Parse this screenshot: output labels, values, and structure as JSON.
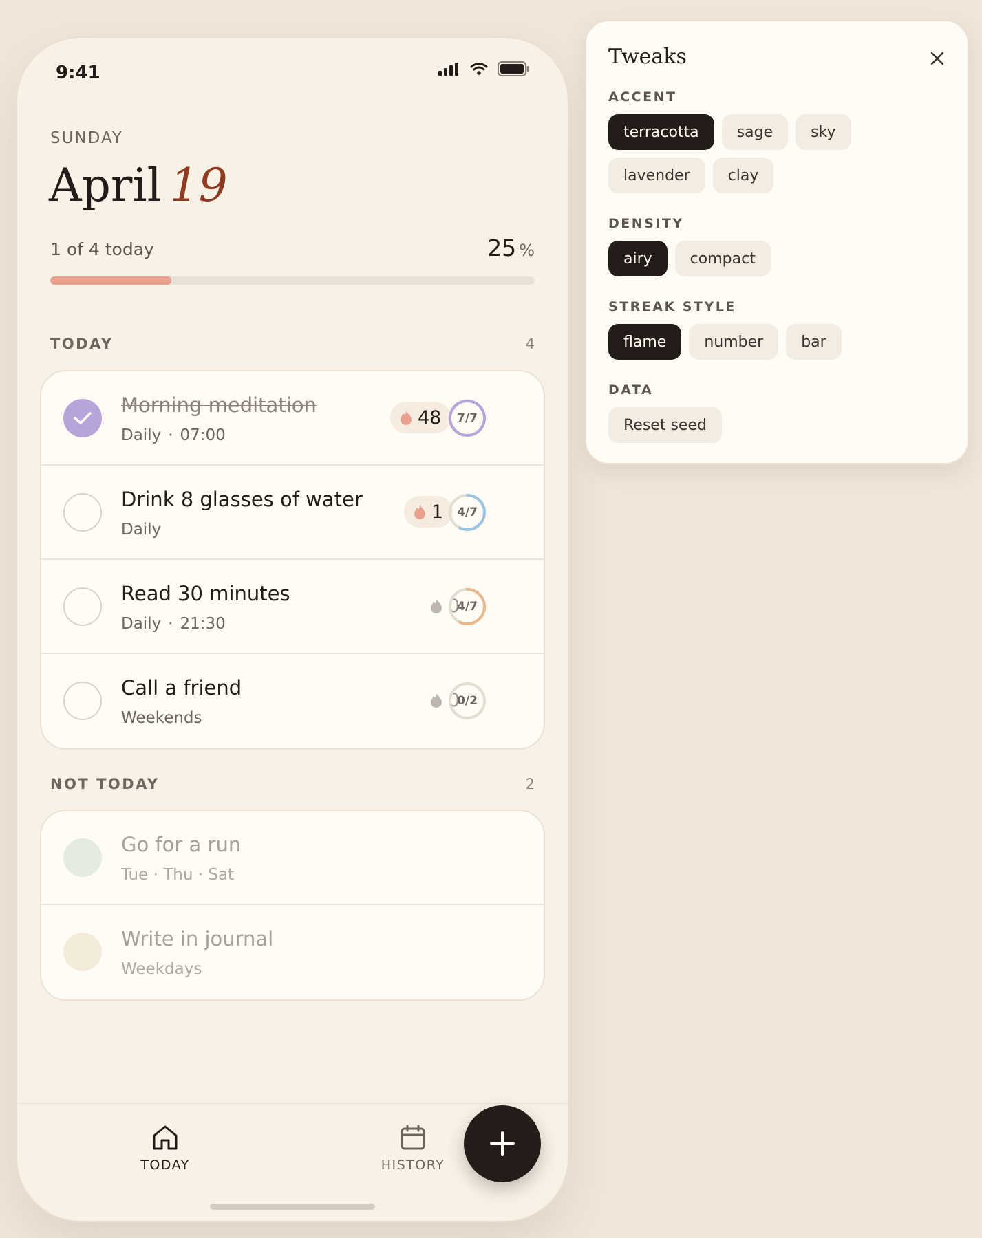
{
  "status": {
    "time": "9:41"
  },
  "header": {
    "weekday": "SUNDAY",
    "month": "April",
    "day": "19"
  },
  "progress": {
    "label": "1 of 4 today",
    "percent": "25",
    "unit": "%",
    "fraction": 0.25,
    "fill_color": "#e8a18c"
  },
  "sections": {
    "today": {
      "title": "TODAY",
      "count": "4"
    },
    "not_today": {
      "title": "NOT TODAY",
      "count": "2"
    }
  },
  "today_habits": [
    {
      "name": "Morning meditation",
      "schedule": "Daily",
      "time": "07:00",
      "done": true,
      "streak": "48",
      "ring": "7/7",
      "ring_fraction": 1.0,
      "ring_color": "#b7a4db"
    },
    {
      "name": "Drink 8 glasses of water",
      "schedule": "Daily",
      "done": false,
      "streak": "1",
      "ring": "4/7",
      "ring_fraction": 0.571,
      "ring_color": "#9cc3e0"
    },
    {
      "name": "Read 30 minutes",
      "schedule": "Daily",
      "time": "21:30",
      "done": false,
      "streak": "0",
      "ring": "4/7",
      "ring_fraction": 0.571,
      "ring_color": "#e8b88c"
    },
    {
      "name": "Call a friend",
      "schedule": "Weekends",
      "done": false,
      "streak": "0",
      "ring": "0/2",
      "ring_fraction": 0,
      "ring_color": "#d9d2c8"
    }
  ],
  "not_today_habits": [
    {
      "name": "Go for a run",
      "schedule": "Tue · Thu · Sat",
      "color": "#e4ebe0"
    },
    {
      "name": "Write in journal",
      "schedule": "Weekdays",
      "color": "#f3ecd8"
    }
  ],
  "nav": {
    "today": "TODAY",
    "history": "HISTORY"
  },
  "colors": {
    "accent": "#8d3c22",
    "dark": "#231c18",
    "background": "#efe6d8",
    "flame": "#e8a18c"
  },
  "tweaks": {
    "title": "Tweaks",
    "accent": {
      "label": "ACCENT",
      "options": [
        "terracotta",
        "sage",
        "sky",
        "lavender",
        "clay"
      ],
      "selected": "terracotta"
    },
    "density": {
      "label": "DENSITY",
      "options": [
        "airy",
        "compact"
      ],
      "selected": "airy"
    },
    "streak_style": {
      "label": "STREAK STYLE",
      "options": [
        "flame",
        "number",
        "bar"
      ],
      "selected": "flame"
    },
    "data": {
      "label": "DATA",
      "reset_label": "Reset seed"
    }
  }
}
